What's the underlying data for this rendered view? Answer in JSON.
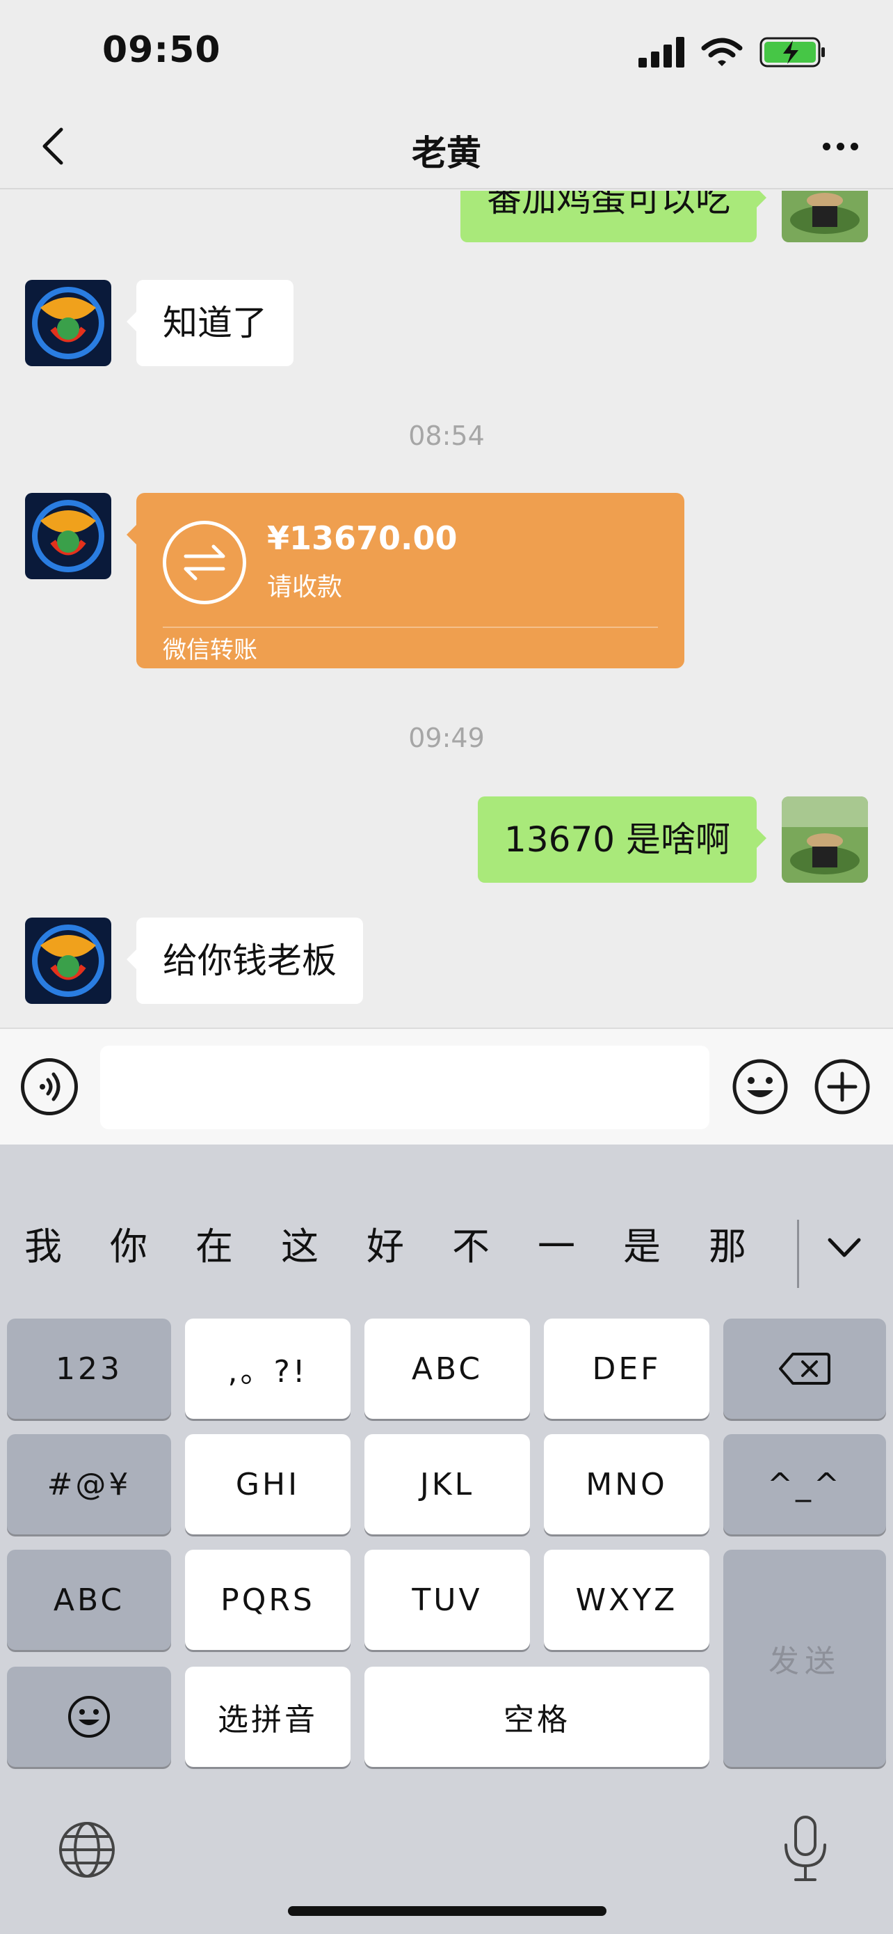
{
  "status_bar": {
    "time": "09:50"
  },
  "nav": {
    "title": "老黄"
  },
  "messages": {
    "m0": {
      "text": "番加鸡蛋可以吃"
    },
    "m1": {
      "text": "知道了"
    },
    "t1": "08:54",
    "transfer": {
      "amount": "¥13670.00",
      "subtitle": "请收款",
      "footer": "微信转账"
    },
    "t2": "09:49",
    "m2": {
      "text": "13670 是啥啊"
    },
    "m3": {
      "text": "给你钱老板"
    }
  },
  "input": {
    "value": ""
  },
  "keyboard": {
    "candidates": [
      "我",
      "你",
      "在",
      "这",
      "好",
      "不",
      "一",
      "是",
      "那"
    ],
    "keys": {
      "numbers": "123",
      "punct": ",。?!",
      "abc": "ABC",
      "def": "DEF",
      "symbols": "#@¥",
      "ghi": "GHI",
      "jkl": "JKL",
      "mno": "MNO",
      "kaomoji": "^_^",
      "abc_mode": "ABC",
      "pqrs": "PQRS",
      "tuv": "TUV",
      "wxyz": "WXYZ",
      "send": "发送",
      "pinyin": "选拼音",
      "space": "空格"
    }
  },
  "colors": {
    "chat_bg": "#ededed",
    "bubble_green": "#a9e97a",
    "transfer_orange": "#ef9f4f",
    "keyboard_bg": "#d1d3d9"
  },
  "icons": [
    "signal-icon",
    "wifi-icon",
    "battery-charging-icon",
    "back-chevron-icon",
    "more-icon",
    "voice-icon",
    "emoji-icon",
    "plus-icon",
    "transfer-icon",
    "delete-icon",
    "chevron-down-icon",
    "globe-icon",
    "mic-icon"
  ]
}
